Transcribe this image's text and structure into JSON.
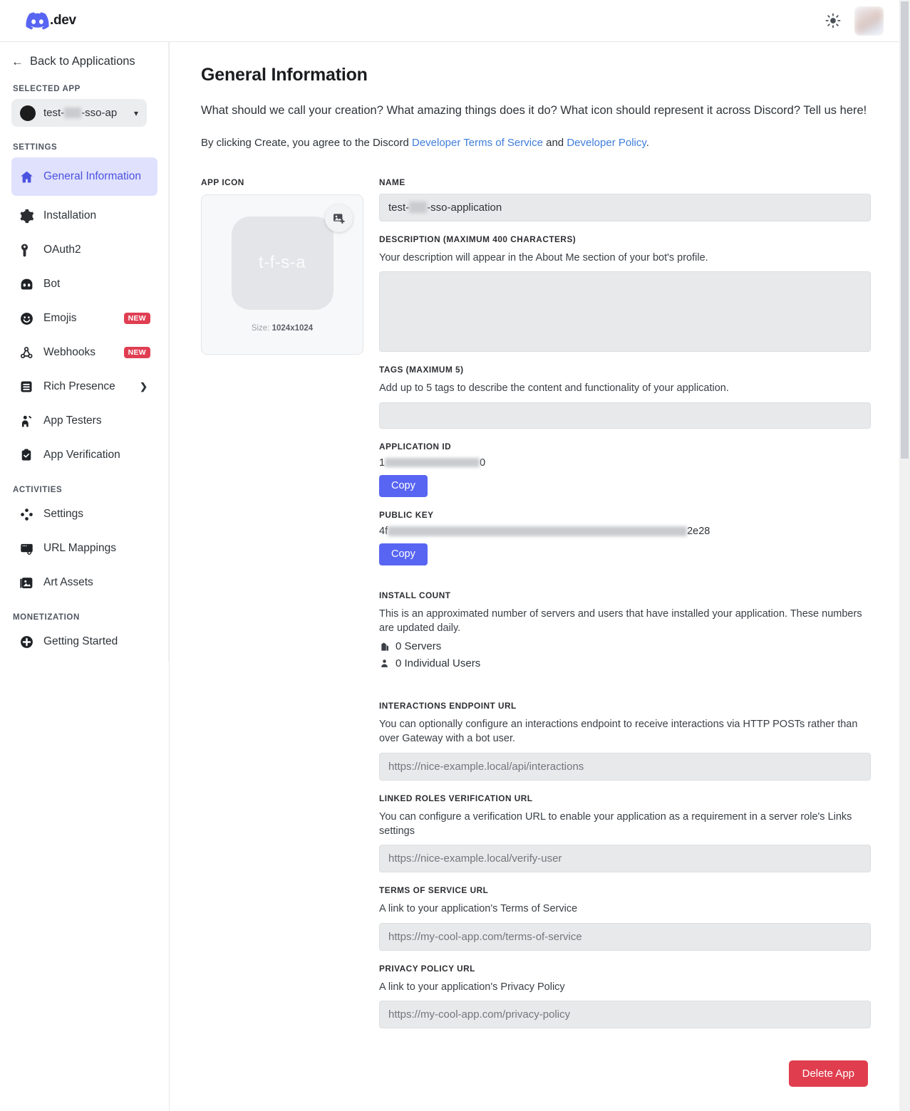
{
  "topbar": {
    "brand_suffix": ".dev",
    "brand_logo_icon": "discord-logo-icon",
    "theme_toggle_icon": "sun-icon",
    "avatar_label": "user-avatar"
  },
  "sidebar": {
    "back_label": "Back to Applications",
    "back_icon": "arrow-left-icon",
    "selected_app_heading": "SELECTED APP",
    "selected_app": {
      "name_prefix": "test-",
      "name_suffix": "-sso-ap",
      "chevron_icon": "chevron-down-icon"
    },
    "groups": [
      {
        "heading": "SETTINGS",
        "items": [
          {
            "label": "General Information",
            "icon": "home-icon",
            "active": true,
            "badge": "",
            "chevron": false
          },
          {
            "label": "Installation",
            "icon": "gear-icon",
            "active": false,
            "badge": "",
            "chevron": false
          },
          {
            "label": "OAuth2",
            "icon": "wrench-icon",
            "active": false,
            "badge": "",
            "chevron": false
          },
          {
            "label": "Bot",
            "icon": "bot-icon",
            "active": false,
            "badge": "",
            "chevron": false
          },
          {
            "label": "Emojis",
            "icon": "smiley-icon",
            "active": false,
            "badge": "NEW",
            "chevron": false
          },
          {
            "label": "Webhooks",
            "icon": "webhook-icon",
            "active": false,
            "badge": "NEW",
            "chevron": false
          },
          {
            "label": "Rich Presence",
            "icon": "list-card-icon",
            "active": false,
            "badge": "",
            "chevron": true
          },
          {
            "label": "App Testers",
            "icon": "person-raising-hand-icon",
            "active": false,
            "badge": "",
            "chevron": false
          },
          {
            "label": "App Verification",
            "icon": "clipboard-check-icon",
            "active": false,
            "badge": "",
            "chevron": false
          }
        ]
      },
      {
        "heading": "ACTIVITIES",
        "items": [
          {
            "label": "Settings",
            "icon": "dpad-icon",
            "active": false,
            "badge": "",
            "chevron": false
          },
          {
            "label": "URL Mappings",
            "icon": "browser-link-icon",
            "active": false,
            "badge": "",
            "chevron": false
          },
          {
            "label": "Art Assets",
            "icon": "image-icon",
            "active": false,
            "badge": "",
            "chevron": false
          }
        ]
      },
      {
        "heading": "MONETIZATION",
        "items": [
          {
            "label": "Getting Started",
            "icon": "plus-circle-icon",
            "active": false,
            "badge": "",
            "chevron": false
          }
        ]
      }
    ]
  },
  "main": {
    "title": "General Information",
    "intro": "What should we call your creation? What amazing things does it do? What icon should represent it across Discord? Tell us here!",
    "terms_prefix": "By clicking Create, you agree to the Discord ",
    "terms_link_1": "Developer Terms of Service",
    "terms_middle": " and ",
    "terms_link_2": "Developer Policy",
    "terms_suffix": ".",
    "app_icon": {
      "label": "APP ICON",
      "initials": "t-f-s-a",
      "size_label": "Size:",
      "size_value": "1024x1024",
      "upload_icon": "add-image-icon"
    },
    "name": {
      "label": "NAME",
      "value_prefix": "test-",
      "value_suffix": "-sso-application"
    },
    "description": {
      "label": "DESCRIPTION (MAXIMUM 400 CHARACTERS)",
      "help": "Your description will appear in the About Me section of your bot's profile.",
      "value": ""
    },
    "tags": {
      "label": "TAGS (MAXIMUM 5)",
      "help": "Add up to 5 tags to describe the content and functionality of your application.",
      "value": ""
    },
    "application_id": {
      "label": "APPLICATION ID",
      "value_prefix": "1",
      "value_suffix": "0",
      "copy_label": "Copy"
    },
    "public_key": {
      "label": "PUBLIC KEY",
      "value_prefix": "4f",
      "value_suffix": "2e28",
      "copy_label": "Copy"
    },
    "install_count": {
      "label": "INSTALL COUNT",
      "help": "This is an approximated number of servers and users that have installed your application. These numbers are updated daily.",
      "servers": "0 Servers",
      "servers_icon": "servers-icon",
      "users": "0 Individual Users",
      "users_icon": "person-icon"
    },
    "interactions_endpoint": {
      "label": "INTERACTIONS ENDPOINT URL",
      "help": "You can optionally configure an interactions endpoint to receive interactions via HTTP POSTs rather than over Gateway with a bot user.",
      "placeholder": "https://nice-example.local/api/interactions"
    },
    "linked_roles": {
      "label": "LINKED ROLES VERIFICATION URL",
      "help": "You can configure a verification URL to enable your application as a requirement in a server role's Links settings",
      "placeholder": "https://nice-example.local/verify-user"
    },
    "terms_of_service": {
      "label": "TERMS OF SERVICE URL",
      "help": "A link to your application's Terms of Service",
      "placeholder": "https://my-cool-app.com/terms-of-service"
    },
    "privacy_policy": {
      "label": "PRIVACY POLICY URL",
      "help": "A link to your application's Privacy Policy",
      "placeholder": "https://my-cool-app.com/privacy-policy"
    },
    "delete_label": "Delete App"
  },
  "colors": {
    "blurple": "#5865F2",
    "active_nav_bg": "#e0e1fd",
    "active_nav_text": "#4b52e0",
    "badge_red": "#e03e52",
    "danger": "#e03e4e",
    "link": "#3f7ddb",
    "input_bg": "#e8e9ea"
  }
}
